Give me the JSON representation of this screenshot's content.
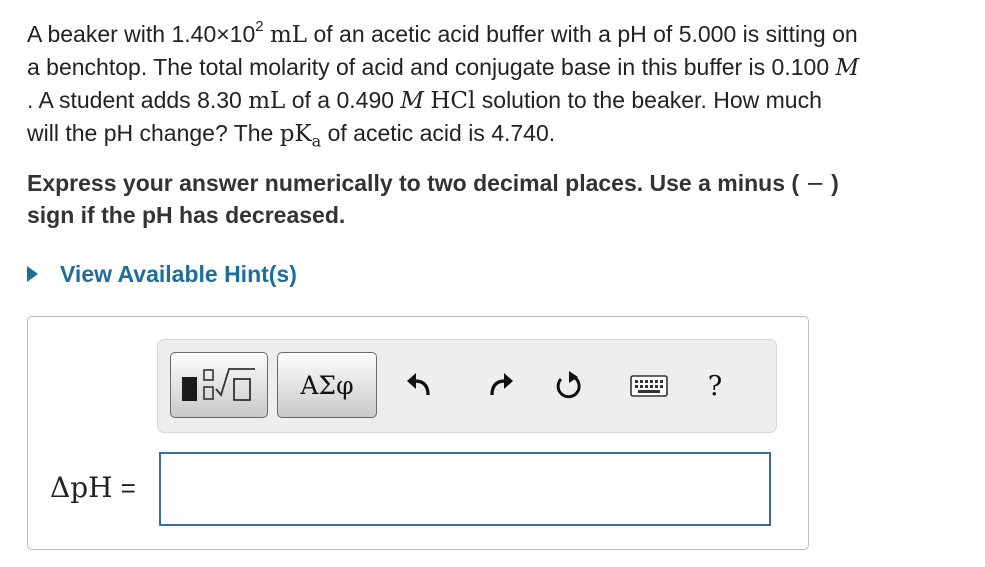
{
  "question": {
    "l1_a": "A beaker with 1.40×10",
    "l1_sup": "2",
    "l1_unit": "mL",
    "l1_b": " of an acetic acid buffer with a pH of 5.000 is sitting on",
    "l2_a": "a benchtop. The total molarity of acid and conjugate base in this buffer is 0.100 ",
    "l2_unit": "M",
    "l3_a": ".  A student adds 8.30 ",
    "l3_unit1": "mL",
    "l3_b": " of a 0.490 ",
    "l3_unit2": "M",
    "l3_chem": "HCl",
    "l3_c": " solution to the beaker. How much",
    "l4_a": "will the pH change? The ",
    "l4_pk": "pK",
    "l4_sub": "a",
    "l4_b": " of acetic acid is 4.740."
  },
  "instructions": {
    "a": "Express your answer numerically to two decimal places. Use a minus ( ",
    "minus": "−",
    "b": " )",
    "c": "sign if the pH has decreased."
  },
  "hint": {
    "label": "View Available Hint(s)"
  },
  "toolbar": {
    "greek_label": "ΑΣφ",
    "help_label": "?",
    "icons": [
      "templates-icon",
      "greek-symbols",
      "undo-icon",
      "redo-icon",
      "reset-icon",
      "keyboard-icon",
      "help-icon"
    ]
  },
  "answer": {
    "label": "ΔpH",
    "equals": "=",
    "value": ""
  },
  "colors": {
    "link": "#1c6e9c",
    "input_border": "#3a6f9a"
  }
}
